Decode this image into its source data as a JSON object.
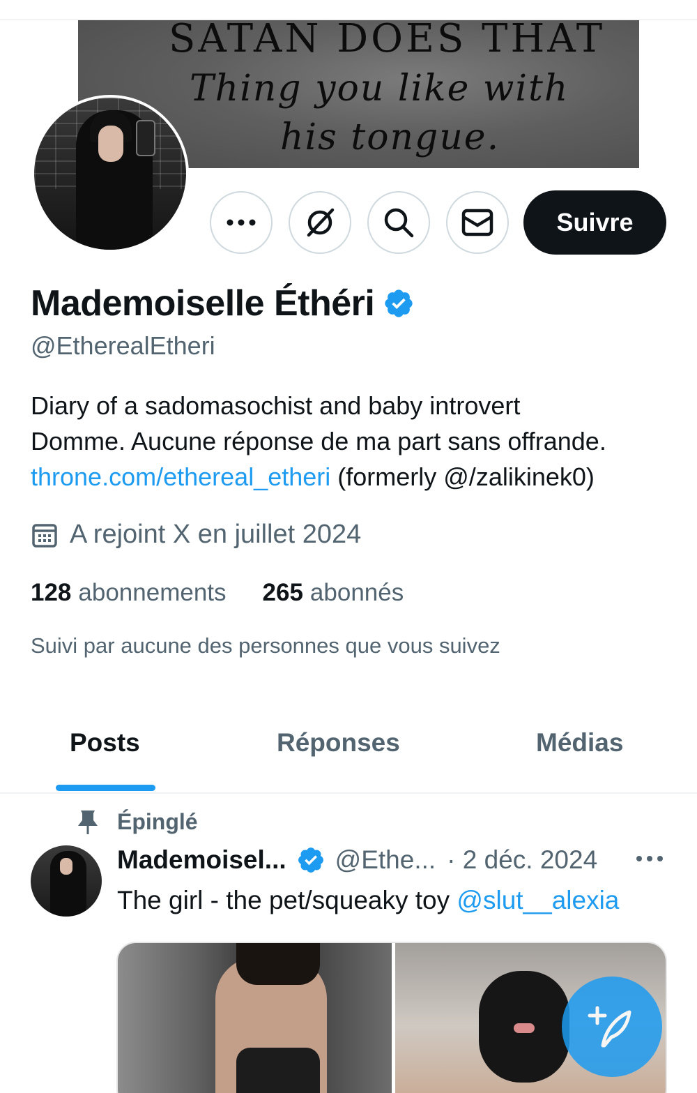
{
  "banner": {
    "line1": "SATAN DOES THAT",
    "line2": "Thing you like with",
    "line3": "his tongue."
  },
  "actions": {
    "more_icon": "more-horizontal-icon",
    "grok_icon": "grok-icon",
    "search_icon": "search-icon",
    "mail_icon": "mail-icon",
    "follow_label": "Suivre"
  },
  "profile": {
    "display_name": "Mademoiselle Éthéri",
    "handle": "@EtherealEtheri",
    "bio_line1": "Diary of a sadomasochist and baby introvert",
    "bio_line2": "Domme. Aucune réponse de ma part sans offrande.",
    "bio_link": "throne.com/ethereal_etheri",
    "bio_after_link": " (formerly @/zalikinek0)",
    "joined": "A rejoint X en juillet 2024",
    "following_count": "128",
    "following_label": "abonnements",
    "followers_count": "265",
    "followers_label": "abonnés",
    "followed_by": "Suivi par aucune des personnes que vous suivez"
  },
  "tabs": [
    {
      "label": "Posts",
      "active": true
    },
    {
      "label": "Réponses",
      "active": false
    },
    {
      "label": "Médias",
      "active": false
    }
  ],
  "post": {
    "pinned_label": "Épinglé",
    "author_name": "Mademoisel...",
    "author_handle": "@Ethe...",
    "separator_date": "· 2 déc. 2024",
    "text_before": "The girl - the pet/squeaky toy ",
    "mention": "@slut__alexia"
  },
  "colors": {
    "accent": "#1d9bf0",
    "text_primary": "#0f1419",
    "text_secondary": "#536471",
    "follow_button_bg": "#0f1419"
  }
}
